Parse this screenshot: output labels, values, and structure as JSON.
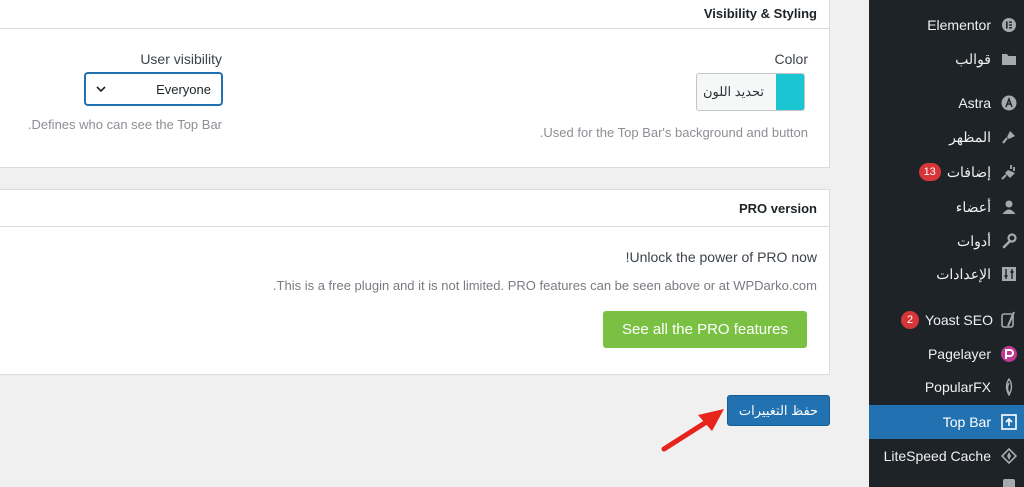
{
  "visibility_panel": {
    "title": "Visibility & Styling",
    "color_label": "Color",
    "color_button_text": "تحديد اللون",
    "color_value": "#1bc5d1",
    "color_help": ".Used for the Top Bar's background and button",
    "user_visibility_label": "User visibility",
    "user_visibility_value": "Everyone",
    "user_visibility_help": ".Defines who can see the Top Bar"
  },
  "pro_panel": {
    "title": "PRO version",
    "headline": "!Unlock the power of PRO now",
    "description": ".This is a free plugin and it is not limited. PRO features can be seen above or at WPDarko.com",
    "button_label": "See all the PRO features"
  },
  "save_button_label": "حفظ التغييرات",
  "sidebar": {
    "items": [
      {
        "label": "Elementor",
        "icon": "elementor-icon"
      },
      {
        "label": "قوالب",
        "icon": "folder-icon"
      },
      {
        "label": "Astra",
        "icon": "astra-icon"
      },
      {
        "label": "المظهر",
        "icon": "appearance-brush-icon"
      },
      {
        "label": "إضافات",
        "icon": "plugins-icon",
        "badge": "13"
      },
      {
        "label": "أعضاء",
        "icon": "users-icon"
      },
      {
        "label": "أدوات",
        "icon": "tools-wrench-icon"
      },
      {
        "label": "الإعدادات",
        "icon": "settings-icon"
      },
      {
        "label": "Yoast SEO",
        "icon": "yoast-icon",
        "badge": "2"
      },
      {
        "label": "Pagelayer",
        "icon": "pagelayer-icon"
      },
      {
        "label": "PopularFX",
        "icon": "popularfx-icon"
      },
      {
        "label": "Top Bar",
        "icon": "top-bar-icon",
        "active": true
      },
      {
        "label": "LiteSpeed Cache",
        "icon": "litespeed-icon"
      }
    ]
  }
}
